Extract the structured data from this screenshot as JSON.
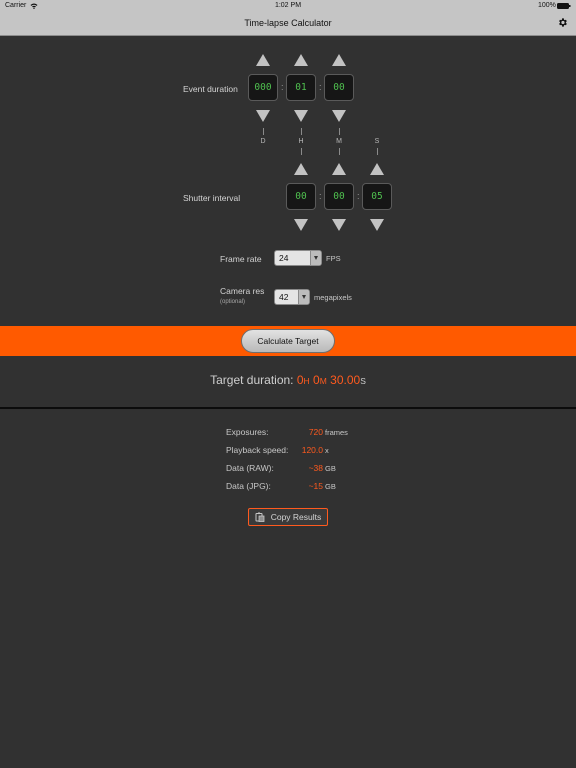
{
  "status_bar": {
    "carrier": "Carrier",
    "time": "1:02 PM",
    "battery": "100%"
  },
  "nav": {
    "title": "Time-lapse Calculator",
    "settings_icon": "gear-icon"
  },
  "event_duration": {
    "label": "Event duration",
    "days": "000",
    "hours": "01",
    "minutes": "00",
    "unit_letters": [
      "D",
      "H",
      "M",
      "S"
    ]
  },
  "shutter_interval": {
    "label": "Shutter interval",
    "minutes": "00",
    "seconds": "00",
    "frames": "05"
  },
  "frame_rate": {
    "label": "Frame rate",
    "value": "24",
    "unit": "FPS"
  },
  "camera_res": {
    "label": "Camera res",
    "sublabel": "(optional)",
    "value": "42",
    "unit": "megapixels"
  },
  "calculate_button": "Calculate Target",
  "target": {
    "label": "Target duration:",
    "hours": "0",
    "hours_unit": "H",
    "minutes": "0",
    "minutes_unit": "M",
    "seconds": "30.00",
    "seconds_unit": "S"
  },
  "results": [
    {
      "label": "Exposures:",
      "value": "720",
      "unit": "frames"
    },
    {
      "label": "Playback speed:",
      "value": "120.0",
      "unit": "x"
    },
    {
      "label": "Data (RAW):",
      "value": "~38",
      "unit": "GB"
    },
    {
      "label": "Data (JPG):",
      "value": "~15",
      "unit": "GB"
    }
  ],
  "copy_button": "Copy Results",
  "colors": {
    "accent": "#ff5a00",
    "digits": "#4fc04f",
    "background": "#313131"
  }
}
